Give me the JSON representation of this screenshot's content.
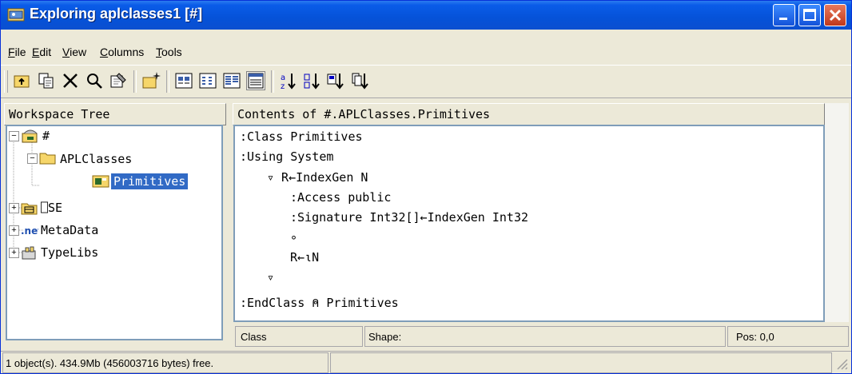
{
  "window": {
    "title": "Exploring aplclasses1 [#]",
    "accent": "#0a5ce8"
  },
  "menu": [
    "File",
    "Edit",
    "View",
    "Columns",
    "Tools"
  ],
  "toolbar": {
    "buttons": [
      "folder-up-icon",
      "copy-icon",
      "delete-icon",
      "find-icon",
      "properties-icon",
      "new-icon",
      "large-icons-view-icon",
      "small-icons-view-icon",
      "list-view-icon",
      "details-view-icon",
      "sort-by-name-icon",
      "sort-by-type-icon",
      "sort-by-size-icon",
      "sort-by-date-icon"
    ]
  },
  "tree": {
    "header": "Workspace Tree",
    "nodes": [
      {
        "label": "#",
        "expander": "⊟",
        "icon": "workspace-icon"
      },
      {
        "label": "APLClasses",
        "expander": "⊟",
        "icon": "folder-icon"
      },
      {
        "label": "Primitives",
        "expander": "",
        "icon": "class-icon",
        "selected": true
      },
      {
        "label": "⎕SE",
        "expander": "⊞",
        "icon": "session-icon"
      },
      {
        "label": "MetaData",
        "expander": "⊞",
        "icon": "metadata-icon"
      },
      {
        "label": "TypeLibs",
        "expander": "⊞",
        "icon": "typelibs-icon"
      }
    ]
  },
  "content": {
    "header": "Contents of #.APLClasses.Primitives",
    "lines": [
      ":Class Primitives",
      ":Using System",
      "▿ R←IndexGen N",
      ":Access public",
      ":Signature Int32[]←IndexGen Int32",
      "∘",
      "R←⍳N",
      "▿",
      ":EndClass ⍝ Primitives"
    ]
  },
  "status": {
    "type": "Class",
    "shape": "Shape:",
    "pos": "Pos: 0,0",
    "free": "1 object(s). 434.9Mb (456003716 bytes) free."
  }
}
